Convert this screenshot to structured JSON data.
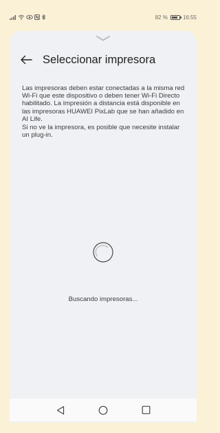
{
  "status_bar": {
    "left_icons": [
      "signal-icon",
      "wifi-icon",
      "eye-comfort-icon",
      "nfc-icon",
      "bluetooth-icon"
    ],
    "battery_percent": "82 %",
    "battery_level": 0.82,
    "time": "16:55"
  },
  "header": {
    "back_icon": "arrow-left-icon",
    "title": "Seleccionar impresora"
  },
  "description": {
    "paragraph1": "Las impresoras deben estar conectadas a la misma red Wi-Fi que este dispositivo o deben tener Wi-Fi Directo habilitado. La impresión a distancia está disponible en las impresoras HUAWEI PixLab que se han añadido en AI Life.",
    "paragraph2": "Si no ve la impresora, es posible que necesite instalar un plug-in."
  },
  "loading": {
    "text": "Buscando impresoras..."
  },
  "nav_bar": {
    "icons": [
      "back-triangle-icon",
      "home-circle-icon",
      "recents-square-icon"
    ]
  },
  "colors": {
    "outer_background": "#fbf1d6",
    "sheet_background": "#f0f1f5",
    "nav_background": "#fafafa",
    "text_primary": "#1f1f1f",
    "text_secondary": "#3b3b3b"
  }
}
